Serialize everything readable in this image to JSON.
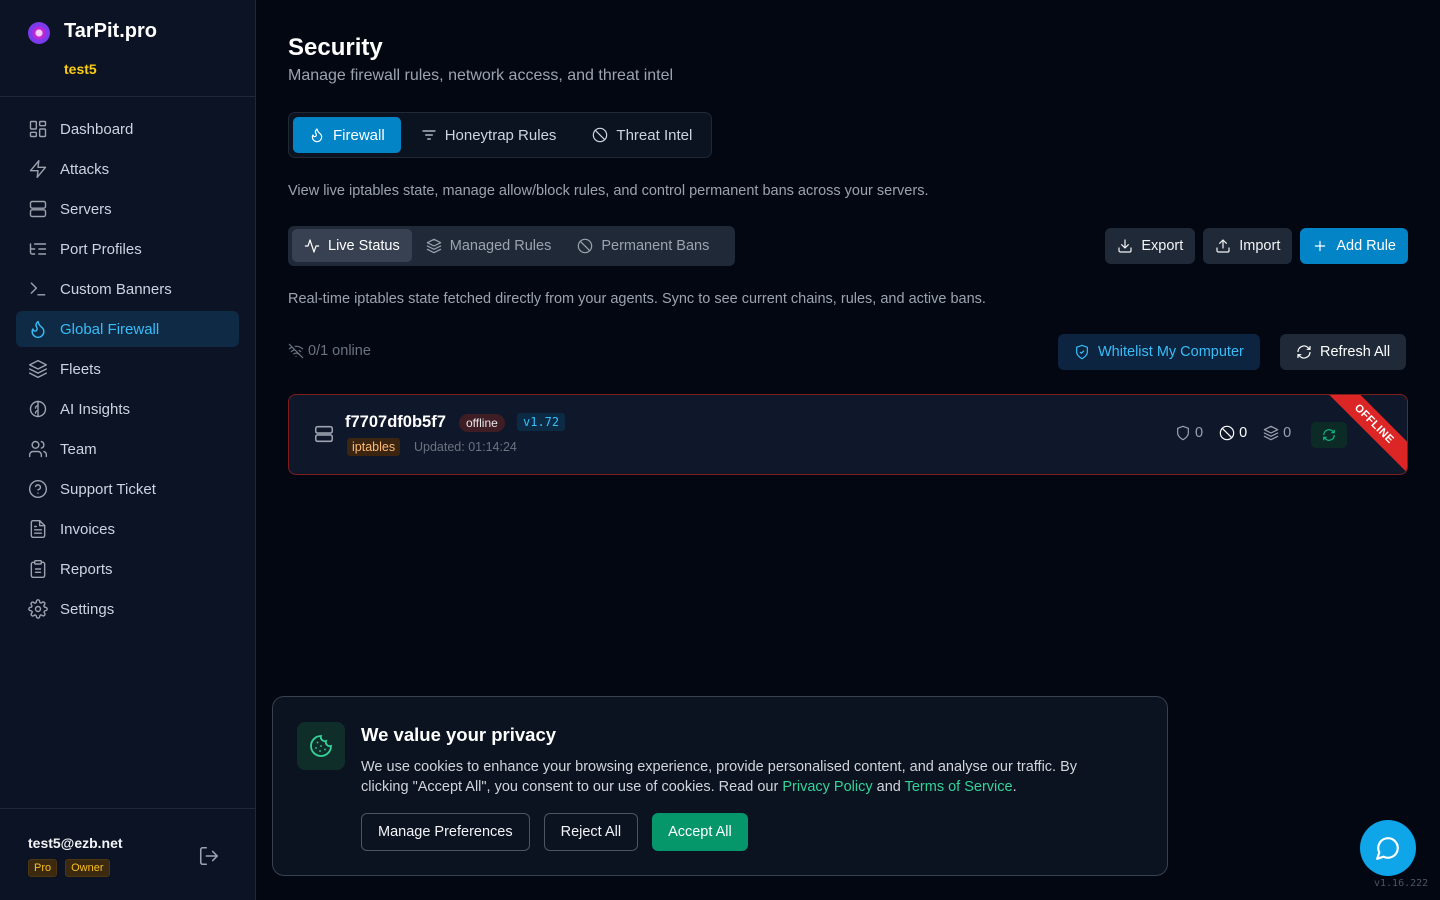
{
  "brand": {
    "name": "TarPit.pro",
    "tenant": "test5"
  },
  "sidebar": {
    "items": [
      {
        "label": "Dashboard",
        "icon": "dashboard-icon"
      },
      {
        "label": "Attacks",
        "icon": "bolt-icon"
      },
      {
        "label": "Servers",
        "icon": "server-icon"
      },
      {
        "label": "Port Profiles",
        "icon": "list-tree-icon"
      },
      {
        "label": "Custom Banners",
        "icon": "terminal-icon"
      },
      {
        "label": "Global Firewall",
        "icon": "flame-icon",
        "active": true
      },
      {
        "label": "Fleets",
        "icon": "layers-icon"
      },
      {
        "label": "AI Insights",
        "icon": "brain-icon"
      },
      {
        "label": "Team",
        "icon": "users-icon"
      },
      {
        "label": "Support Ticket",
        "icon": "help-circle-icon"
      },
      {
        "label": "Invoices",
        "icon": "file-text-icon"
      },
      {
        "label": "Reports",
        "icon": "clipboard-icon"
      },
      {
        "label": "Settings",
        "icon": "gear-icon"
      }
    ],
    "user": {
      "email": "test5@ezb.net",
      "badges": [
        "Pro",
        "Owner"
      ]
    }
  },
  "page": {
    "title": "Security",
    "subtitle": "Manage firewall rules, network access, and threat intel",
    "tabs": [
      "Firewall",
      "Honeytrap Rules",
      "Threat Intel"
    ],
    "active_tab": "Firewall",
    "firewall_description": "View live iptables state, manage allow/block rules, and control permanent bans across your servers.",
    "subtabs": [
      "Live Status",
      "Managed Rules",
      "Permanent Bans"
    ],
    "active_subtab": "Live Status",
    "actions": {
      "export": "Export",
      "import": "Import",
      "add_rule": "Add Rule"
    },
    "live_description": "Real-time iptables state fetched directly from your agents. Sync to see current chains, rules, and active bans.",
    "online_status": "0/1 online",
    "whitelist_button": "Whitelist My Computer",
    "refresh_button": "Refresh All"
  },
  "servers": [
    {
      "hostname": "f7707df0b5f7",
      "status": "offline",
      "version": "v1.72",
      "backend": "iptables",
      "updated": "Updated: 01:14:24",
      "rules_count": "0",
      "bans_count": "0",
      "chains_count": "0",
      "ribbon": "OFFLINE"
    }
  ],
  "cookie_banner": {
    "title": "We value your privacy",
    "text_before": "We use cookies to enhance your browsing experience, provide personalised content, and analyse our traffic. By clicking \"Accept All\", you consent to our use of cookies. Read our ",
    "privacy_link": "Privacy Policy",
    "text_and": " and ",
    "terms_link": "Terms of Service",
    "text_end": ".",
    "buttons": {
      "manage": "Manage Preferences",
      "reject": "Reject All",
      "accept": "Accept All"
    }
  },
  "app_version": "v1.16.222",
  "colors": {
    "accent": "#0284c7",
    "success": "#059669",
    "danger": "#dc2626",
    "warning": "#facc15"
  }
}
